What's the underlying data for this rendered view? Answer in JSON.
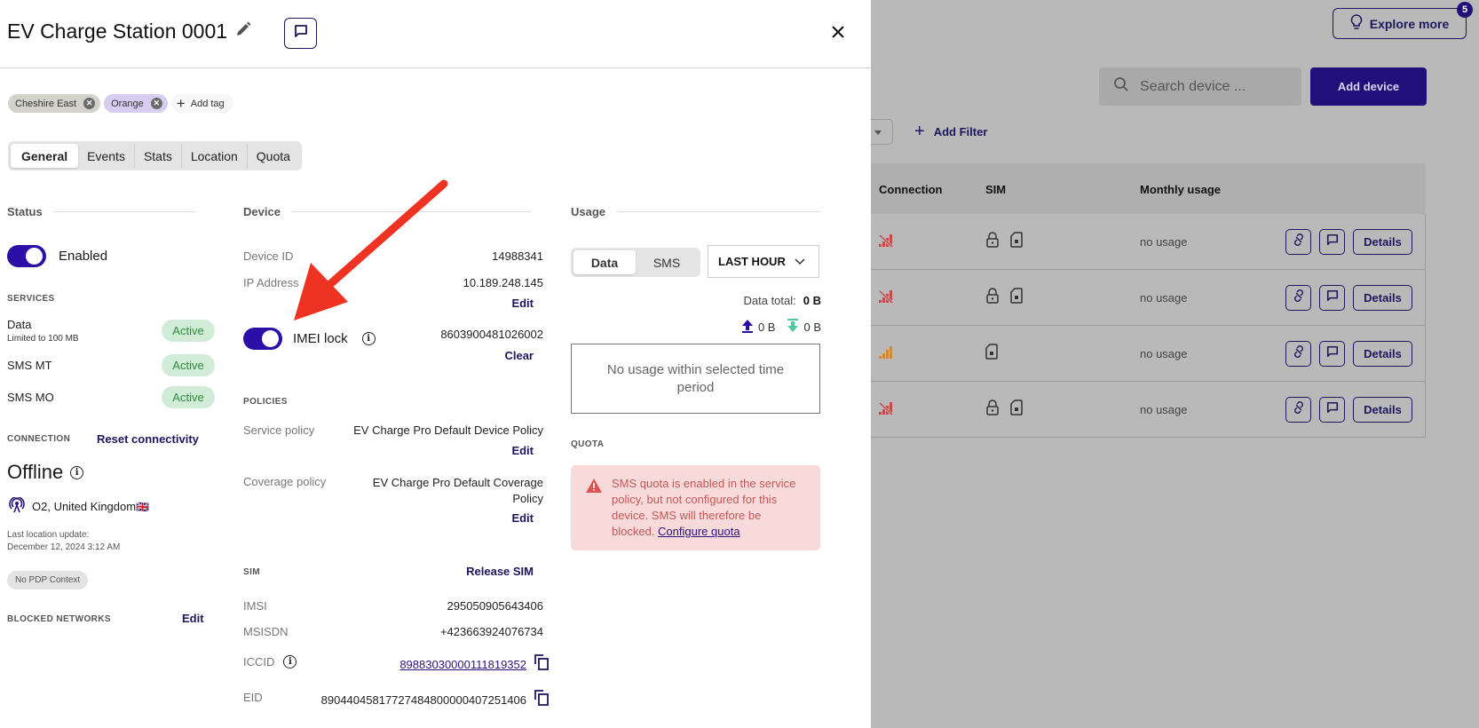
{
  "background": {
    "explore_more": {
      "label": "Explore more",
      "badge": "5",
      "icon": "lightbulb-icon"
    },
    "search": {
      "placeholder": "Search device ...",
      "icon": "search-icon"
    },
    "add_device_label": "Add device",
    "add_filter_label": "Add Filter",
    "table": {
      "columns": [
        "Connection",
        "SIM",
        "Monthly usage"
      ],
      "rows": [
        {
          "connection": "no-signal",
          "sim_lock": true,
          "usage": "no usage",
          "details_label": "Details"
        },
        {
          "connection": "no-signal",
          "sim_lock": true,
          "usage": "no usage",
          "details_label": "Details"
        },
        {
          "connection": "weak-signal",
          "sim_lock": false,
          "usage": "no usage",
          "details_label": "Details"
        },
        {
          "connection": "no-signal",
          "sim_lock": true,
          "usage": "no usage",
          "details_label": "Details"
        }
      ]
    }
  },
  "drawer": {
    "title": "EV Charge Station 0001",
    "tags": [
      {
        "label": "Cheshire East",
        "color": "#d3d3cc"
      },
      {
        "label": "Orange",
        "color": "#d7cdf0"
      }
    ],
    "add_tag_label": "Add tag",
    "tabs": [
      {
        "label": "General",
        "active": true
      },
      {
        "label": "Events",
        "active": false
      },
      {
        "label": "Stats",
        "active": false
      },
      {
        "label": "Location",
        "active": false
      },
      {
        "label": "Quota",
        "active": false
      }
    ],
    "status": {
      "heading": "Status",
      "enabled": true,
      "enabled_label": "Enabled",
      "services_heading": "SERVICES",
      "services": [
        {
          "name": "Data",
          "sub": "Limited to 100 MB",
          "state": "Active"
        },
        {
          "name": "SMS MT",
          "sub": "",
          "state": "Active"
        },
        {
          "name": "SMS MO",
          "sub": "",
          "state": "Active"
        }
      ],
      "connection_heading": "CONNECTION",
      "reset_label": "Reset connectivity",
      "state": "Offline",
      "network": "O2, United Kingdom",
      "flag": "🇬🇧",
      "last_update_label": "Last location update:",
      "last_update_value": "December 12, 2024 3:12 AM",
      "pdp_badge": "No PDP Context",
      "blocked_heading": "BLOCKED NETWORKS",
      "blocked_edit": "Edit"
    },
    "device": {
      "heading": "Device",
      "device_id_label": "Device ID",
      "device_id": "14988341",
      "ip_label": "IP Address",
      "ip": "10.189.248.145",
      "ip_edit": "Edit",
      "imei_lock_enabled": true,
      "imei_lock_label": "IMEI lock",
      "imei": "8603900481026002",
      "imei_clear": "Clear",
      "policies_heading": "POLICIES",
      "service_policy_label": "Service policy",
      "service_policy": "EV Charge Pro Default Device Policy",
      "service_policy_edit": "Edit",
      "coverage_policy_label": "Coverage policy",
      "coverage_policy": "EV Charge Pro Default Coverage Policy",
      "coverage_policy_edit": "Edit",
      "sim_heading": "SIM",
      "release_sim": "Release SIM",
      "imsi_label": "IMSI",
      "imsi": "295050905643406",
      "msisdn_label": "MSISDN",
      "msisdn": "+423663924076734",
      "iccid_label": "ICCID",
      "iccid": "89883030000111819352",
      "eid_label": "EID",
      "eid": "89044045817727484800000407251406"
    },
    "usage": {
      "heading": "Usage",
      "segments": [
        {
          "label": "Data",
          "active": true
        },
        {
          "label": "SMS",
          "active": false
        }
      ],
      "period": "LAST HOUR",
      "data_total_label": "Data total:",
      "data_total": "0 B",
      "upload": "0 B",
      "download": "0 B",
      "upload_color": "#2a0fa6",
      "download_color": "#4fc89a",
      "empty_message": "No usage within selected time period",
      "quota_heading": "QUOTA",
      "quota_alert": "SMS quota is enabled in the service policy, but not configured for this device. SMS will therefore be blocked.",
      "quota_link": "Configure quota"
    }
  },
  "colors": {
    "primary": "#22107a",
    "toggle": "#2b0fa6",
    "active_badge_bg": "#d1ecd6",
    "active_badge_text": "#2f8a3e",
    "alert_bg": "#f9dada",
    "alert_text": "#c45858",
    "annotation_arrow": "#ee3322"
  }
}
